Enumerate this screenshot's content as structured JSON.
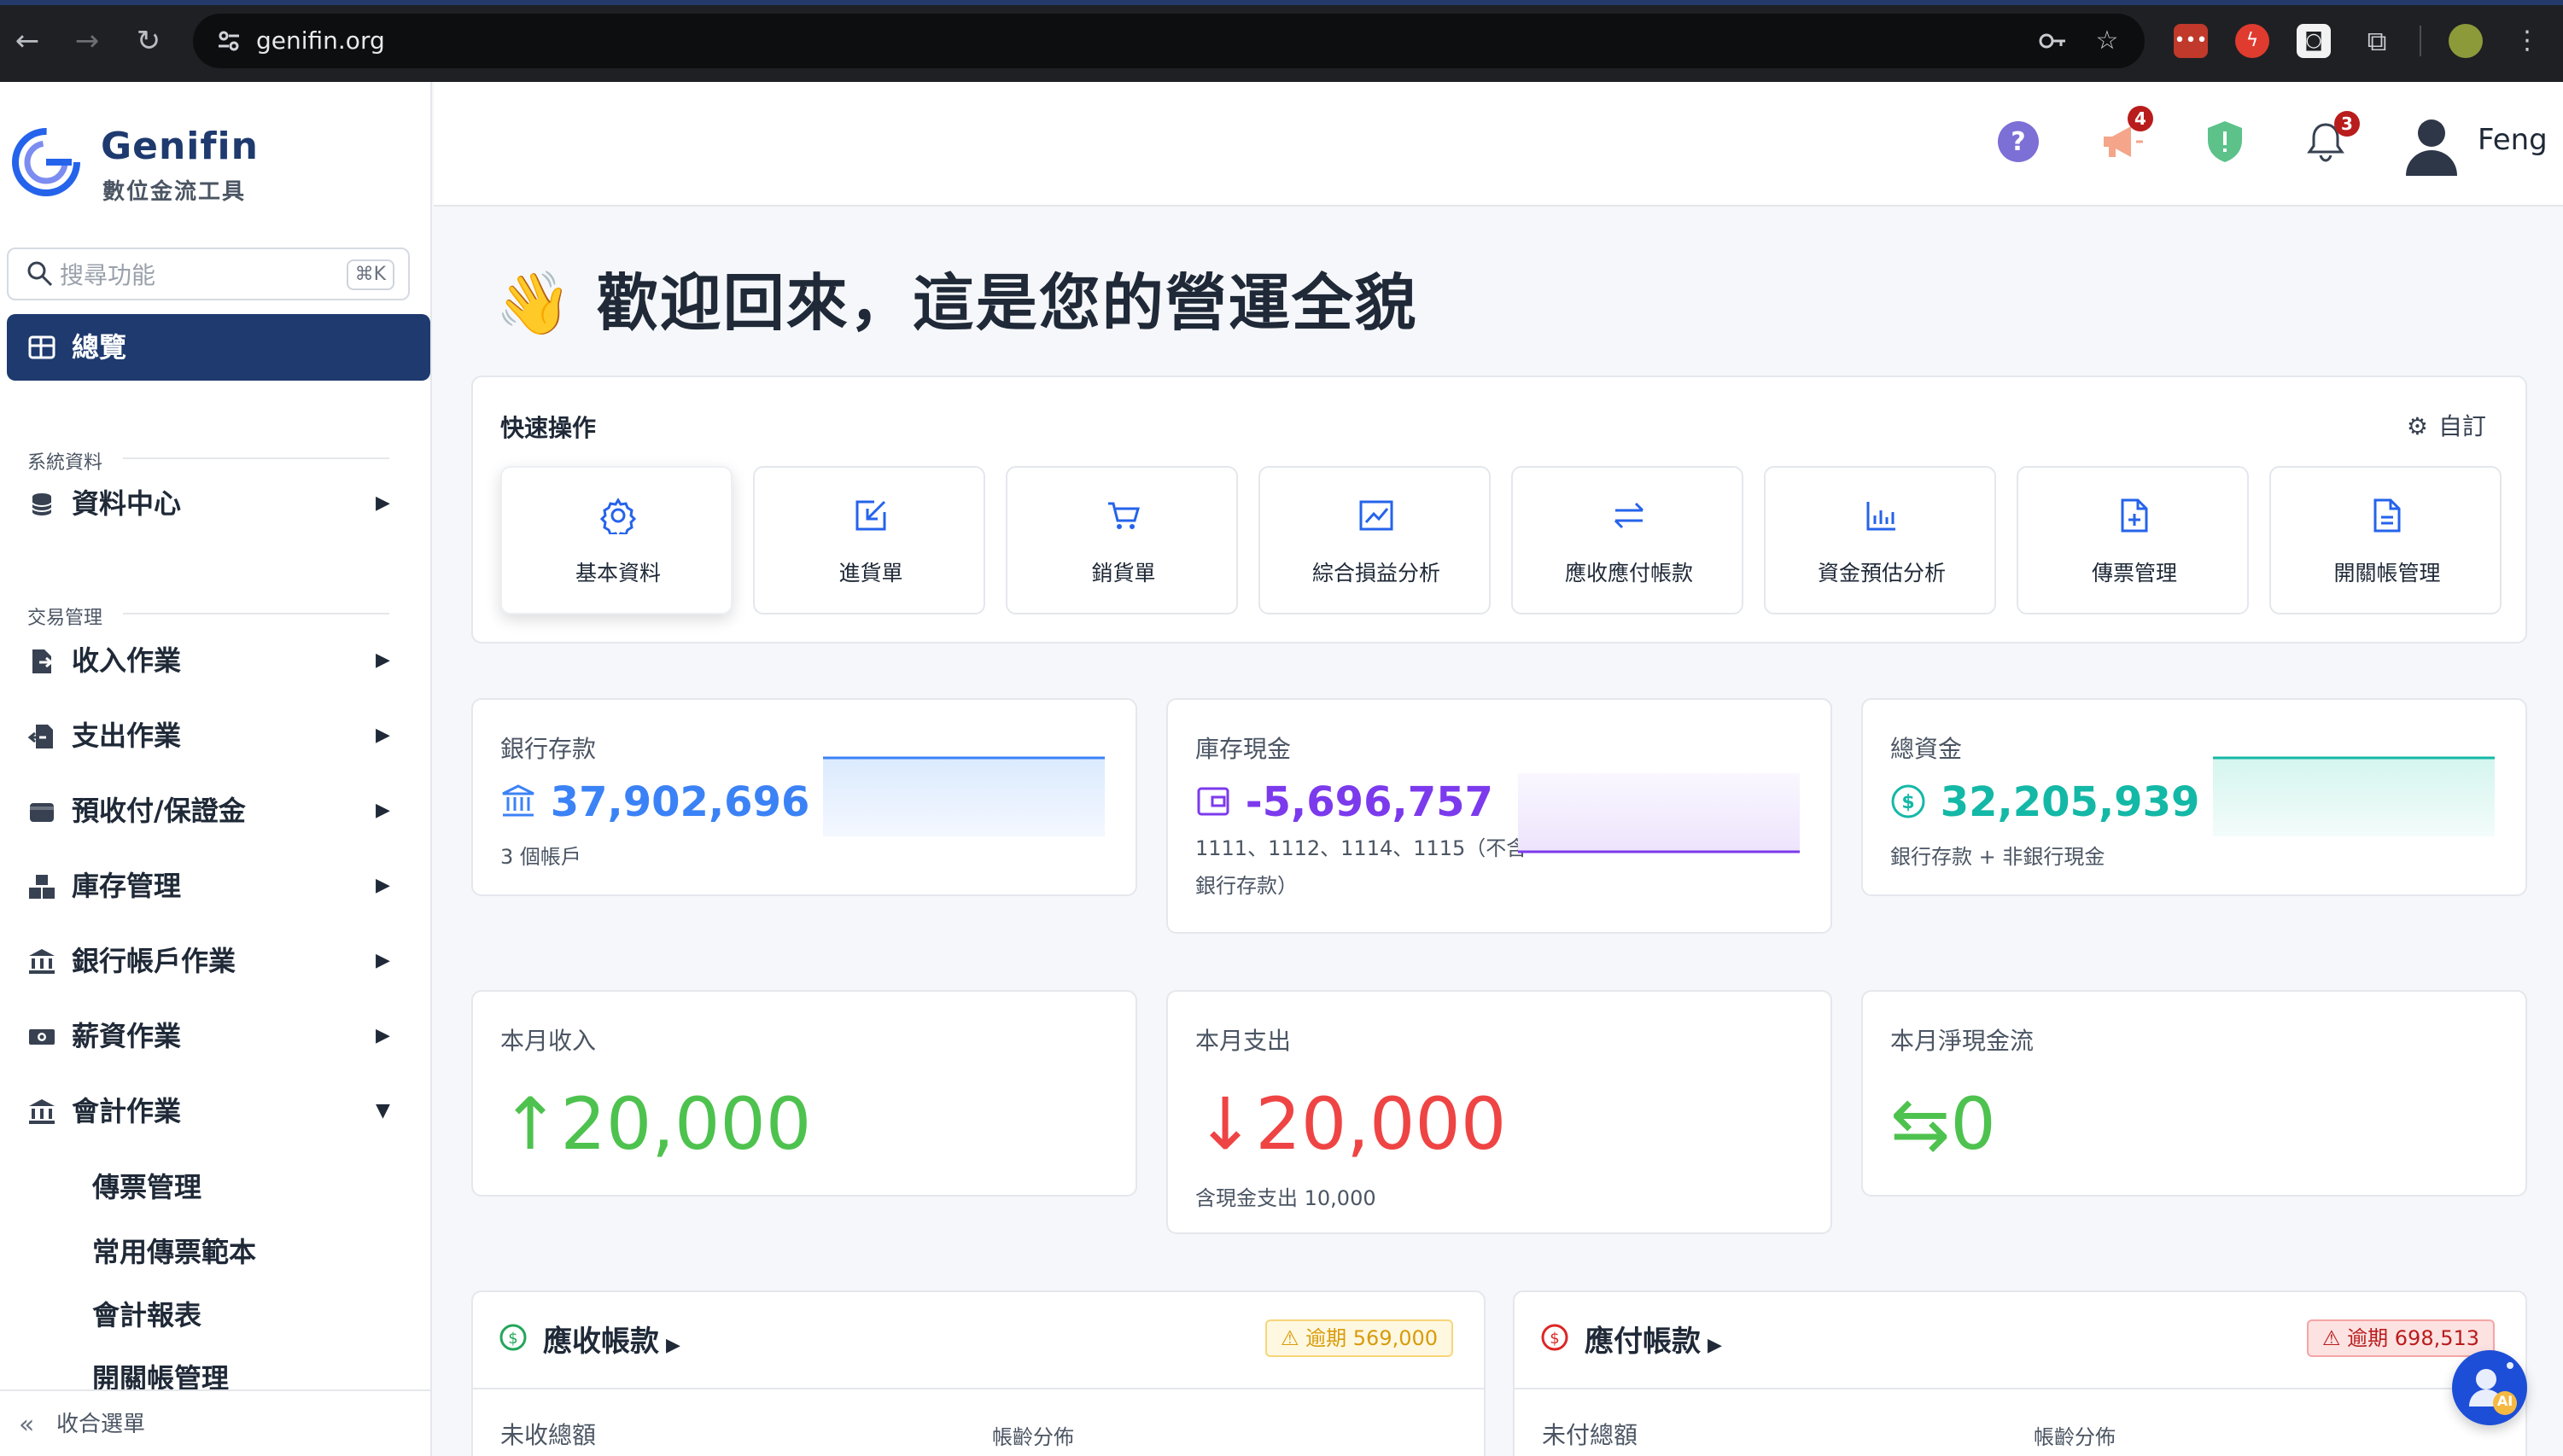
{
  "browser": {
    "url": "genifin.org"
  },
  "brand": {
    "name": "Genifin",
    "subtitle": "數位金流工具"
  },
  "sidebar": {
    "search_placeholder": "搜尋功能",
    "search_shortcut": "⌘K",
    "active_item": "總覽",
    "sections": {
      "system": "系統資料",
      "trade": "交易管理"
    },
    "items": [
      {
        "label": "資料中心",
        "icon": "database-icon"
      },
      {
        "label": "收入作業",
        "icon": "file-import-icon"
      },
      {
        "label": "支出作業",
        "icon": "file-export-icon"
      },
      {
        "label": "預收付/保證金",
        "icon": "wallet-icon"
      },
      {
        "label": "庫存管理",
        "icon": "boxes-icon"
      },
      {
        "label": "銀行帳戶作業",
        "icon": "bank-icon"
      },
      {
        "label": "薪資作業",
        "icon": "money-icon"
      },
      {
        "label": "會計作業",
        "icon": "bank-icon"
      }
    ],
    "sub_items": [
      "傳票管理",
      "常用傳票範本",
      "會計報表",
      "開關帳管理"
    ],
    "collapse_label": "收合選單"
  },
  "header": {
    "notice_badge": "4",
    "bell_badge": "3",
    "user_name": "Feng"
  },
  "main": {
    "welcome": "歡迎回來，這是您的營運全貌",
    "quick_actions": {
      "title": "快速操作",
      "customize_label": "自訂",
      "items": [
        {
          "label": "基本資料",
          "icon": "gear-icon"
        },
        {
          "label": "進貨單",
          "icon": "inbound-icon"
        },
        {
          "label": "銷貨單",
          "icon": "cart-icon"
        },
        {
          "label": "綜合損益分析",
          "icon": "trend-chart-icon"
        },
        {
          "label": "應收應付帳款",
          "icon": "exchange-icon"
        },
        {
          "label": "資金預估分析",
          "icon": "bar-chart-icon"
        },
        {
          "label": "傳票管理",
          "icon": "file-plus-icon"
        },
        {
          "label": "開關帳管理",
          "icon": "document-icon"
        }
      ]
    },
    "balances": [
      {
        "label": "銀行存款",
        "value": "37,902,696",
        "sub": "3 個帳戶",
        "color": "#3b82f6"
      },
      {
        "label": "庫存現金",
        "value": "-5,696,757",
        "sub": "1111、1112、1114、1115（不含銀行存款）",
        "color": "#7c3aed"
      },
      {
        "label": "總資金",
        "value": "32,205,939",
        "sub": "銀行存款 + 非銀行現金",
        "color": "#14b8a6"
      }
    ],
    "monthly": [
      {
        "label": "本月收入",
        "value": "20,000",
        "sub": "",
        "color": "#4ec24e"
      },
      {
        "label": "本月支出",
        "value": "20,000",
        "sub": "含現金支出 10,000",
        "color": "#ef4444"
      },
      {
        "label": "本月淨現金流",
        "value": "0",
        "sub": "",
        "color": "#4ec24e"
      }
    ],
    "receivable": {
      "title": "應收帳款",
      "overdue": "逾期 569,000",
      "col1": "未收總額",
      "col2": "帳齡分佈"
    },
    "payable": {
      "title": "應付帳款",
      "overdue": "逾期 698,513",
      "col1": "未付總額",
      "col2": "帳齡分佈"
    },
    "ai_label": "AI"
  }
}
